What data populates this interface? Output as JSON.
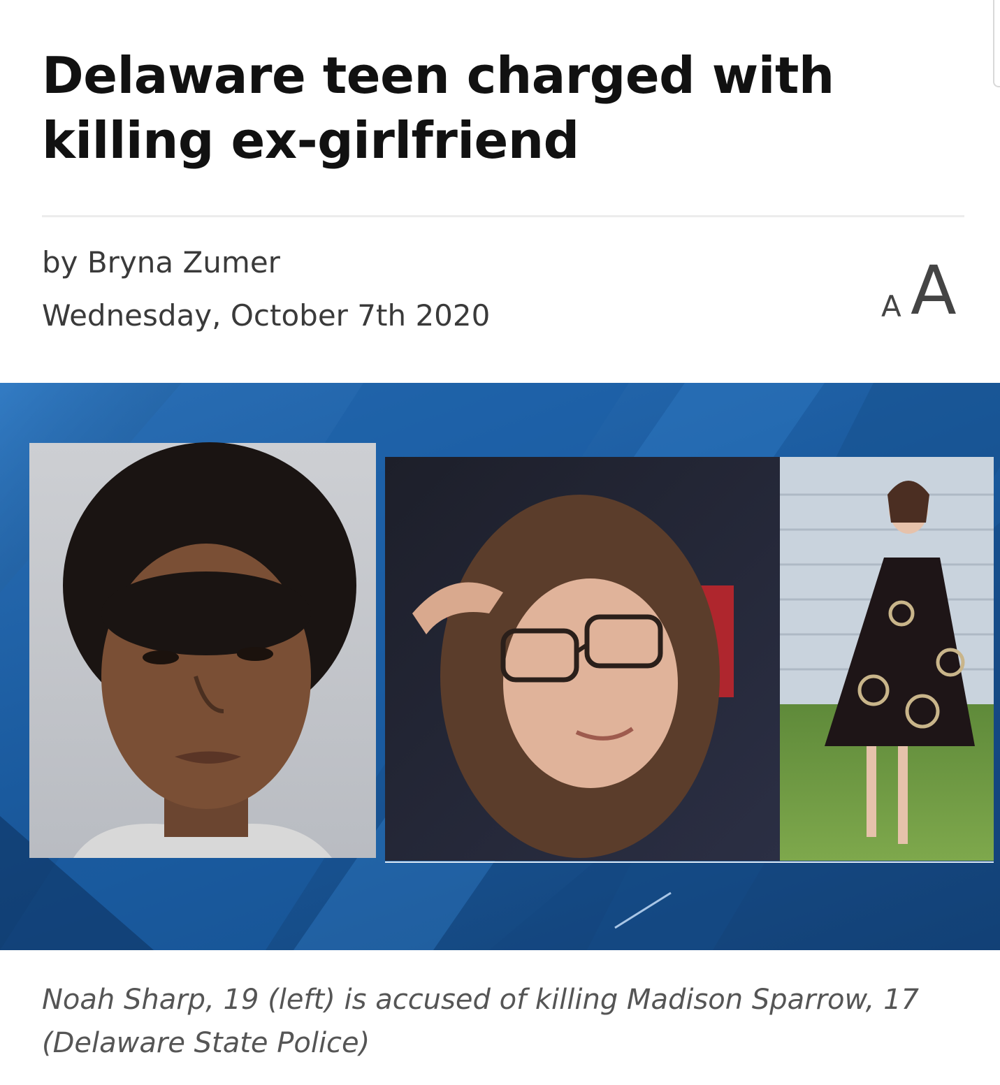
{
  "article": {
    "headline": "Delaware teen charged with killing ex-girlfriend",
    "byline": "by Bryna Zumer",
    "date": "Wednesday, October 7th 2020"
  },
  "controls": {
    "font_size_small": "A",
    "font_size_large": "A",
    "font_size_icon": "font-size-toggle-icon"
  },
  "photo": {
    "description_icon": "news-photo",
    "caption": "Noah Sharp, 19 (left) is accused of killing Madison Sparrow, 17 (Delaware State Police)"
  },
  "colors": {
    "headline": "#111111",
    "meta_text": "#3a3a3a",
    "caption_text": "#555555",
    "divider": "#ececec",
    "photo_bg": "#1a5a9e"
  }
}
